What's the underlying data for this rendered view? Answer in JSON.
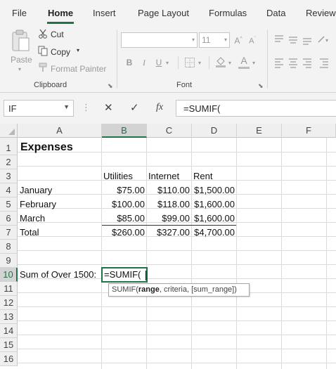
{
  "ribbon_tabs": [
    "File",
    "Home",
    "Insert",
    "Page Layout",
    "Formulas",
    "Data",
    "Review"
  ],
  "active_tab": "Home",
  "clipboard": {
    "paste_label": "Paste",
    "cut_label": "Cut",
    "copy_label": "Copy",
    "format_painter_label": "Format Painter",
    "group_label": "Clipboard"
  },
  "font": {
    "font_size": "11",
    "group_label": "Font"
  },
  "formula_bar": {
    "name_box": "IF",
    "formula": "=SUMIF(",
    "fx_symbol": "fx"
  },
  "columns": [
    "A",
    "B",
    "C",
    "D",
    "E",
    "F"
  ],
  "selected_column": "B",
  "rows": [
    "1",
    "2",
    "3",
    "4",
    "5",
    "6",
    "7",
    "8",
    "9",
    "10",
    "11",
    "12",
    "13",
    "14",
    "15",
    "16"
  ],
  "selected_row": "10",
  "sheet": {
    "title": "Expenses",
    "headers": [
      "Utilities",
      "Internet",
      "Rent"
    ],
    "data_rows": [
      {
        "label": "January",
        "values": [
          "$75.00",
          "$110.00",
          "$1,500.00"
        ]
      },
      {
        "label": "February",
        "values": [
          "$100.00",
          "$118.00",
          "$1,600.00"
        ]
      },
      {
        "label": "March",
        "values": [
          "$85.00",
          "$99.00",
          "$1,600.00"
        ]
      },
      {
        "label": "Total",
        "values": [
          "$260.00",
          "$327.00",
          "$4,700.00"
        ]
      }
    ],
    "sum_label": "Sum of Over 1500:",
    "editing_value": "=SUMIF("
  },
  "tooltip": {
    "fn": "SUMIF(",
    "bold_arg": "range",
    "rest": ", criteria, [sum_range])"
  },
  "colors": {
    "accent": "#217346",
    "ribbon_bg": "#f3f3f3"
  }
}
